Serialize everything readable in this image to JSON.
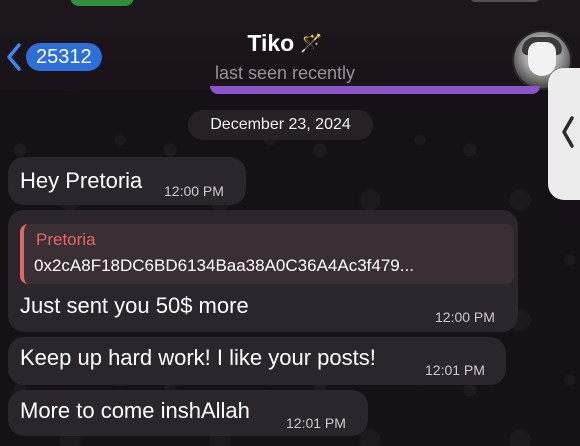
{
  "header": {
    "back_count": "25312",
    "contact_name": "Tiko",
    "name_emoji": "🪄",
    "status": "last seen recently"
  },
  "chat": {
    "date": "December 23, 2024",
    "messages": [
      {
        "text": "Hey Pretoria",
        "time": "12:00 PM"
      },
      {
        "reply": {
          "name": "Pretoria",
          "text": "0x2cA8F18DC6BD6134Baa38A0C36A4Ac3f479..."
        },
        "text": "Just sent you 50$ more",
        "time": "12:00 PM"
      },
      {
        "text": "Keep up hard work! I like your posts!",
        "time": "12:01 PM"
      },
      {
        "text": "More to come inshAllah",
        "time": "12:01 PM"
      }
    ]
  },
  "colors": {
    "badge": "#2e6ed8",
    "quote_accent": "#e06767",
    "pinned_bar": "#8b55c9",
    "bubble": "#2b262d"
  }
}
